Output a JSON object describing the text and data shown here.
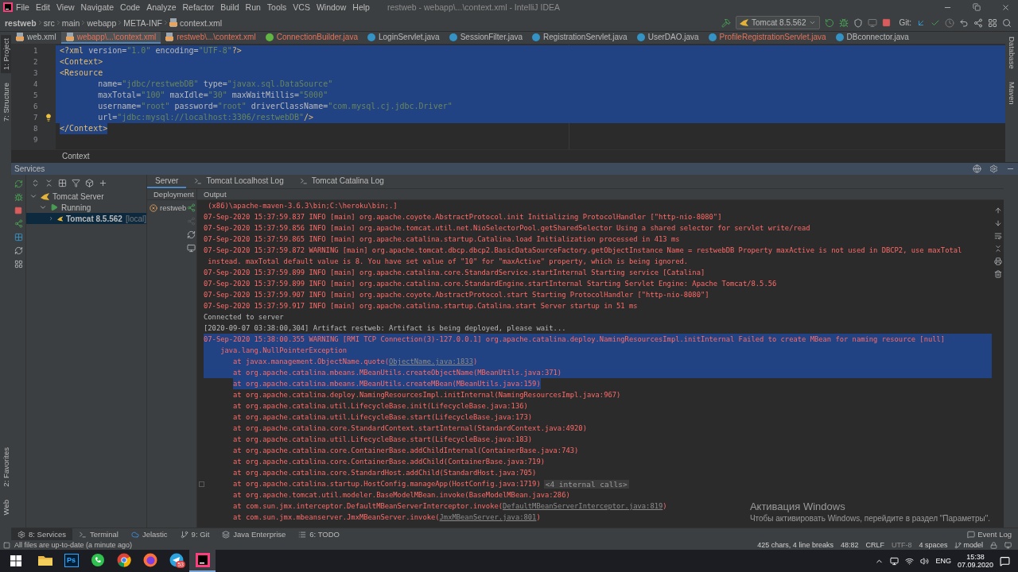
{
  "menu": {
    "items": [
      "File",
      "Edit",
      "View",
      "Navigate",
      "Code",
      "Analyze",
      "Refactor",
      "Build",
      "Run",
      "Tools",
      "VCS",
      "Window",
      "Help"
    ],
    "title": "restweb - webapp\\...\\context.xml - IntelliJ IDEA"
  },
  "navigation": {
    "breadcrumbs": [
      {
        "label": "restweb",
        "kind": "project"
      },
      {
        "label": "src",
        "kind": "folder"
      },
      {
        "label": "main",
        "kind": "folder"
      },
      {
        "label": "webapp",
        "kind": "folder"
      },
      {
        "label": "META-INF",
        "kind": "folder"
      },
      {
        "label": "context.xml",
        "kind": "file"
      }
    ],
    "run_config": "Tomcat 8.5.562",
    "git_label": "Git:"
  },
  "side_stripes": {
    "left_top": [
      {
        "label": "1: Project",
        "selected": true
      },
      {
        "label": "7: Structure",
        "selected": false
      }
    ],
    "left_bottom": [
      {
        "label": "2: Favorites",
        "selected": false
      },
      {
        "label": "Web",
        "selected": false
      }
    ],
    "right": [
      {
        "label": "Database",
        "selected": false
      },
      {
        "label": "Maven",
        "selected": false
      }
    ]
  },
  "editor_tabs": [
    {
      "label": "web.xml",
      "kind": "xml",
      "selected": false,
      "error": false
    },
    {
      "label": "webapp\\...\\context.xml",
      "kind": "xml",
      "selected": true,
      "error": true
    },
    {
      "label": "restweb\\...\\context.xml",
      "kind": "xml",
      "selected": false,
      "error": true
    },
    {
      "label": "ConnectionBuilder.java",
      "kind": "interface",
      "selected": false,
      "error": true
    },
    {
      "label": "LoginServlet.java",
      "kind": "class",
      "selected": false,
      "error": false
    },
    {
      "label": "SessionFilter.java",
      "kind": "class",
      "selected": false,
      "error": false
    },
    {
      "label": "RegistrationServlet.java",
      "kind": "class",
      "selected": false,
      "error": false
    },
    {
      "label": "UserDAO.java",
      "kind": "class",
      "selected": false,
      "error": false
    },
    {
      "label": "ProfileRegistrationServlet.java",
      "kind": "class",
      "selected": false,
      "error": true
    },
    {
      "label": "DBconnector.java",
      "kind": "class",
      "selected": false,
      "error": false
    }
  ],
  "editor": {
    "lines": [
      {
        "number": "1",
        "text": "<?xml version=\"1.0\" encoding=\"UTF-8\"?>",
        "selected": true,
        "intention": false
      },
      {
        "number": "2",
        "text": "<Context>",
        "selected": true,
        "intention": false
      },
      {
        "number": "3",
        "text": "<Resource",
        "selected": true,
        "intention": false
      },
      {
        "number": "4",
        "text": "        name=\"jdbc/restwebDB\" type=\"javax.sql.DataSource\"",
        "selected": true,
        "intention": false
      },
      {
        "number": "5",
        "text": "        maxTotal=\"100\" maxIdle=\"30\" maxWaitMillis=\"5000\"",
        "selected": true,
        "intention": false
      },
      {
        "number": "6",
        "text": "        username=\"root\" password=\"root\" driverClassName=\"com.mysql.cj.jdbc.Driver\"",
        "selected": true,
        "intention": false
      },
      {
        "number": "7",
        "text": "        url=\"jdbc:mysql://localhost:3306/restwebDB\"/>",
        "selected": true,
        "intention": true
      },
      {
        "number": "8",
        "text": "</Context>",
        "selected": true,
        "intention": false
      },
      {
        "number": "9",
        "selected": false,
        "intention": false
      }
    ],
    "breadcrumb": "Context"
  },
  "services": {
    "title": "Services",
    "tree": [
      {
        "label": "Tomcat Server",
        "kind": "server",
        "expanded": true,
        "selected": false,
        "children": [
          {
            "label": "Running",
            "kind": "running",
            "expanded": true,
            "selected": false,
            "children": [
              {
                "label": "Tomcat 8.5.562",
                "suffix": "[local]",
                "kind": "instance",
                "expanded": false,
                "selected": true
              }
            ]
          }
        ]
      }
    ],
    "tabs": [
      {
        "label": "Server",
        "kind": "plain",
        "selected": true
      },
      {
        "label": "Tomcat Localhost Log",
        "kind": "log",
        "selected": false
      },
      {
        "label": "Tomcat Catalina Log",
        "kind": "log",
        "selected": false
      }
    ],
    "deployment_header": "Deployment",
    "output_header": "Output",
    "deployments": [
      {
        "name": "restweb",
        "failed": true
      }
    ],
    "console": [
      {
        "kind": "wrap",
        "error": true,
        "selected": false,
        "text": "(x86)\\apache-maven-3.6.3\\bin;C:\\heroku\\bin;.]"
      },
      {
        "kind": "log",
        "error": true,
        "selected": false,
        "text": "07-Sep-2020 15:37:59.837 INFO [main] org.apache.coyote.AbstractProtocol.init Initializing ProtocolHandler [\"http-nio-8080\"]"
      },
      {
        "kind": "log",
        "error": true,
        "selected": false,
        "text": "07-Sep-2020 15:37:59.856 INFO [main] org.apache.tomcat.util.net.NioSelectorPool.getSharedSelector Using a shared selector for servlet write/read"
      },
      {
        "kind": "log",
        "error": true,
        "selected": false,
        "text": "07-Sep-2020 15:37:59.865 INFO [main] org.apache.catalina.startup.Catalina.load Initialization processed in 413 ms"
      },
      {
        "kind": "log",
        "error": true,
        "selected": false,
        "text": "07-Sep-2020 15:37:59.872 WARNING [main] org.apache.tomcat.dbcp.dbcp2.BasicDataSourceFactory.getObjectInstance Name = restwebDB Property maxActive is not used in DBCP2, use maxTotal"
      },
      {
        "kind": "wrap",
        "error": true,
        "selected": false,
        "text": "instead. maxTotal default value is 8. You have set value of \"10\" for \"maxActive\" property, which is being ignored."
      },
      {
        "kind": "log",
        "error": true,
        "selected": false,
        "text": "07-Sep-2020 15:37:59.899 INFO [main] org.apache.catalina.core.StandardService.startInternal Starting service [Catalina]"
      },
      {
        "kind": "log",
        "error": true,
        "selected": false,
        "text": "07-Sep-2020 15:37:59.899 INFO [main] org.apache.catalina.core.StandardEngine.startInternal Starting Servlet Engine: Apache Tomcat/8.5.56"
      },
      {
        "kind": "log",
        "error": true,
        "selected": false,
        "text": "07-Sep-2020 15:37:59.907 INFO [main] org.apache.coyote.AbstractProtocol.start Starting ProtocolHandler [\"http-nio-8080\"]"
      },
      {
        "kind": "log",
        "error": true,
        "selected": false,
        "text": "07-Sep-2020 15:37:59.917 INFO [main] org.apache.catalina.startup.Catalina.start Server startup in 51 ms"
      },
      {
        "kind": "log",
        "error": false,
        "selected": false,
        "text": "Connected to server"
      },
      {
        "kind": "log",
        "error": false,
        "selected": false,
        "text": "[2020-09-07 03:38:00,304] Artifact restweb: Artifact is being deployed, please wait..."
      },
      {
        "kind": "log",
        "error": true,
        "selected": true,
        "text": "07-Sep-2020 15:38:00.355 WARNING [RMI TCP Connection(3)-127.0.0.1] org.apache.catalina.deploy.NamingResourcesImpl.initInternal Failed to create MBean for naming resource [null]"
      },
      {
        "kind": "exception",
        "error": true,
        "selected": true,
        "text": "java.lang.NullPointerException"
      },
      {
        "kind": "stack",
        "error": true,
        "selected": true,
        "text": "at javax.management.ObjectName.quote(",
        "link": "ObjectName.java:1833",
        "tail": ")"
      },
      {
        "kind": "stack",
        "error": true,
        "selected": true,
        "text": "at org.apache.catalina.mbeans.MBeanUtils.createObjectName(MBeanUtils.java:371)"
      },
      {
        "kind": "stack",
        "error": true,
        "selected": true,
        "text": "at org.apache.catalina.mbeans.MBeanUtils.createMBean(MBeanUtils.java:159)"
      },
      {
        "kind": "stack",
        "error": true,
        "selected": false,
        "text": "at org.apache.catalina.deploy.NamingResourcesImpl.initInternal(NamingResourcesImpl.java:967)"
      },
      {
        "kind": "stack",
        "error": true,
        "selected": false,
        "text": "at org.apache.catalina.util.LifecycleBase.init(LifecycleBase.java:136)"
      },
      {
        "kind": "stack",
        "error": true,
        "selected": false,
        "text": "at org.apache.catalina.util.LifecycleBase.start(LifecycleBase.java:173)"
      },
      {
        "kind": "stack",
        "error": true,
        "selected": false,
        "text": "at org.apache.catalina.core.StandardContext.startInternal(StandardContext.java:4920)"
      },
      {
        "kind": "stack",
        "error": true,
        "selected": false,
        "text": "at org.apache.catalina.util.LifecycleBase.start(LifecycleBase.java:183)"
      },
      {
        "kind": "stack",
        "error": true,
        "selected": false,
        "text": "at org.apache.catalina.core.ContainerBase.addChildInternal(ContainerBase.java:743)"
      },
      {
        "kind": "stack",
        "error": true,
        "selected": false,
        "text": "at org.apache.catalina.core.ContainerBase.addChild(ContainerBase.java:719)"
      },
      {
        "kind": "stack",
        "error": true,
        "selected": false,
        "text": "at org.apache.catalina.core.StandardHost.addChild(StandardHost.java:705)"
      },
      {
        "kind": "stack",
        "error": true,
        "selected": false,
        "text": "at org.apache.catalina.startup.HostConfig.manageApp(HostConfig.java:1719)",
        "badge": "<4 internal calls>"
      },
      {
        "kind": "stack",
        "error": true,
        "selected": false,
        "text": "at org.apache.tomcat.util.modeler.BaseModelMBean.invoke(BaseModelMBean.java:286)"
      },
      {
        "kind": "stack",
        "error": true,
        "selected": false,
        "text": "at com.sun.jmx.interceptor.DefaultMBeanServerInterceptor.invoke(",
        "link": "DefaultMBeanServerInterceptor.java:819",
        "tail": ")"
      },
      {
        "kind": "stack",
        "error": true,
        "selected": false,
        "text": "at com.sun.jmx.mbeanserver.JmxMBeanServer.invoke(",
        "link": "JmxMBeanServer.java:801",
        "tail": ")"
      }
    ]
  },
  "activation_notice": {
    "title": "Активация Windows",
    "text": "Чтобы активировать Windows, перейдите в раздел \"Параметры\"."
  },
  "tool_windows": {
    "items": [
      {
        "label": "8: Services",
        "kind": "services",
        "selected": true
      },
      {
        "label": "Terminal",
        "kind": "terminal",
        "selected": false
      },
      {
        "label": "Jelastic",
        "kind": "cloud",
        "selected": false
      },
      {
        "label": "9: Git",
        "kind": "git",
        "selected": false
      },
      {
        "label": "Java Enterprise",
        "kind": "enterprise",
        "selected": false
      },
      {
        "label": "6: TODO",
        "kind": "todo",
        "selected": false
      }
    ],
    "event_log": "Event Log"
  },
  "status_bar": {
    "message": "All files are up-to-date (a minute ago)",
    "items": [
      {
        "label": "425 chars, 4 line breaks",
        "kind": "text",
        "disabled": false
      },
      {
        "label": "48:82",
        "kind": "text",
        "disabled": false
      },
      {
        "label": "CRLF",
        "kind": "text",
        "disabled": false
      },
      {
        "label": "UTF-8",
        "kind": "text",
        "disabled": true
      },
      {
        "label": "4 spaces",
        "kind": "text",
        "disabled": false
      },
      {
        "label": "model",
        "kind": "branch",
        "disabled": false
      }
    ]
  },
  "taskbar": {
    "apps": [
      {
        "kind": "explorer",
        "selected": false
      },
      {
        "kind": "photoshop",
        "label": "Ps",
        "selected": false
      },
      {
        "kind": "whatsapp",
        "selected": false
      },
      {
        "kind": "chrome",
        "selected": false
      },
      {
        "kind": "firefox",
        "selected": false
      },
      {
        "kind": "telegram",
        "badge": "53",
        "selected": false
      },
      {
        "kind": "intellij",
        "selected": true
      }
    ],
    "language": "ENG",
    "time": "15:38",
    "date": "07.09.2020"
  }
}
